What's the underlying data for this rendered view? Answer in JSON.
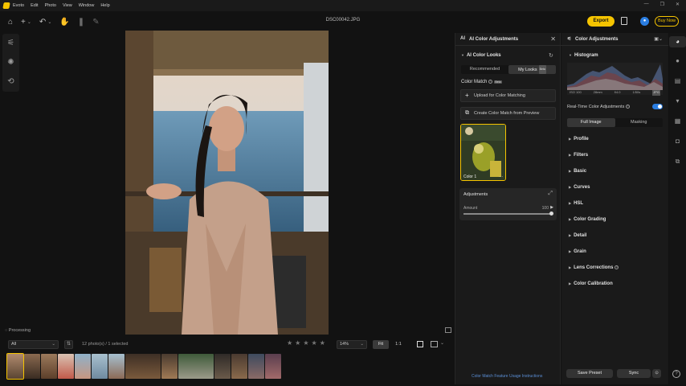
{
  "menubar": {
    "items": [
      "Evoto",
      "Edit",
      "Photo",
      "View",
      "Window",
      "Help"
    ],
    "window_controls": [
      "—",
      "❐",
      "✕"
    ]
  },
  "toolbar": {
    "file_name": "DSC00042.JPG",
    "export_label": "Export",
    "buy_label": "Buy Now",
    "accent_color": "#f5c400"
  },
  "canvas": {
    "status": "Processing"
  },
  "filmstrip": {
    "filter_value": "All",
    "count_text": "12 photo(s) / 1 selected",
    "zoom_value": "14%",
    "fit_label": "Fit",
    "one_to_one_label": "1:1",
    "thumb_count": 14
  },
  "ai_panel": {
    "title": "AI Color Adjustments",
    "section_title": "AI Color Looks",
    "tabs": [
      "Recommended",
      "My Looks"
    ],
    "beta_badge": "Beta",
    "color_match_label": "Color Match",
    "upload_label": "Upload for Color Matching",
    "create_label": "Create Color Match from Preview",
    "look_label": "Color 1",
    "look_more": "···",
    "adjustments_title": "Adjustments",
    "amount_label": "Amount",
    "amount_value": "100",
    "amount_fraction": 1.0,
    "instructions_link": "Color Match Feature Usage Instructions"
  },
  "color_panel": {
    "title": "Color Adjustments",
    "histogram_title": "Histogram",
    "meta": [
      "ISO 100",
      "28mm",
      "f/4.0",
      "1/50s",
      "JPG"
    ],
    "realtime_label": "Real-Time Color Adjustments",
    "realtime_on": true,
    "tabs": [
      "Full Image",
      "Masking"
    ],
    "sections": [
      "Profile",
      "Filters",
      "Basic",
      "Curves",
      "HSL",
      "Color Grading",
      "Detail",
      "Grain",
      "Lens Corrections",
      "Color Calibration"
    ],
    "save_preset_label": "Save Preset",
    "sync_label": "Sync",
    "help": "?"
  }
}
